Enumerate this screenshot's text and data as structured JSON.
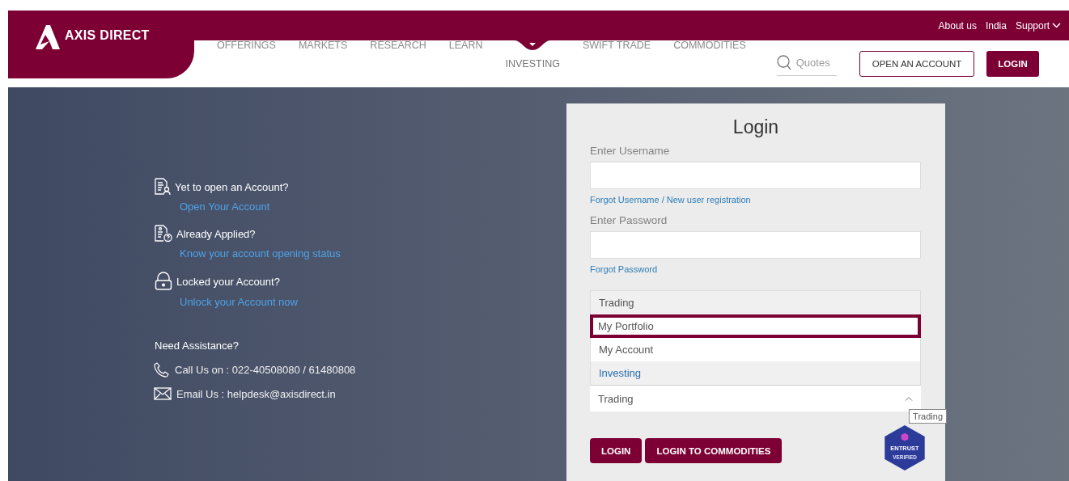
{
  "header": {
    "logo": "AXIS DIRECT",
    "top_links": [
      {
        "label": "About us",
        "dropdown": false
      },
      {
        "label": "India",
        "dropdown": false
      },
      {
        "label": "Support",
        "dropdown": true
      }
    ],
    "nav": [
      {
        "label": "OFFERINGS",
        "selected": false
      },
      {
        "label": "MARKETS",
        "selected": false
      },
      {
        "label": "RESEARCH",
        "selected": false
      },
      {
        "label": "LEARN",
        "selected": false
      },
      {
        "label": "INVESTING",
        "selected": true
      },
      {
        "label": "SWIFT TRADE",
        "selected": false
      },
      {
        "label": "COMMODITIES",
        "selected": false
      }
    ],
    "search": {
      "placeholder": "Quotes"
    },
    "open_account_button": "OPEN AN ACCOUNT",
    "login_button": "LOGIN"
  },
  "help": {
    "items": [
      {
        "kind": "new",
        "title": "Yet to open an Account?",
        "link": "Open Your Account"
      },
      {
        "kind": "applied",
        "title": "Already Applied?",
        "link": "Know your account opening status"
      },
      {
        "kind": "locked",
        "title": "Locked your Account?",
        "link": "Unlock your Account now"
      }
    ],
    "assistance_title": "Need Assistance?",
    "contacts": [
      {
        "kind": "phone",
        "text": "Call Us on : 022-40508080 / 61480808"
      },
      {
        "kind": "email",
        "text": "Email Us : helpdesk@axisdirect.in"
      }
    ]
  },
  "login": {
    "title": "Login",
    "username_label": "Enter Username",
    "forgot_username": "Forgot Username",
    "separator": "/",
    "new_user": "New user registration",
    "password_label": "Enter Password",
    "forgot_password": "Forgot Password",
    "options": [
      {
        "label": "Trading",
        "kind": "group",
        "color": "#555555",
        "selected": false
      },
      {
        "label": "My Portfolio",
        "kind": "option",
        "selected": true
      },
      {
        "label": "My Account",
        "kind": "option",
        "selected": false
      },
      {
        "label": "Investing",
        "kind": "group",
        "color": "#2a6db0",
        "selected": false
      }
    ],
    "select_value": "Trading",
    "tooltip": "Trading",
    "buttons": [
      "LOGIN",
      "LOGIN TO COMMODITIES"
    ],
    "badge": {
      "name": "ENTRUST",
      "caption": "VERIFIED"
    }
  }
}
